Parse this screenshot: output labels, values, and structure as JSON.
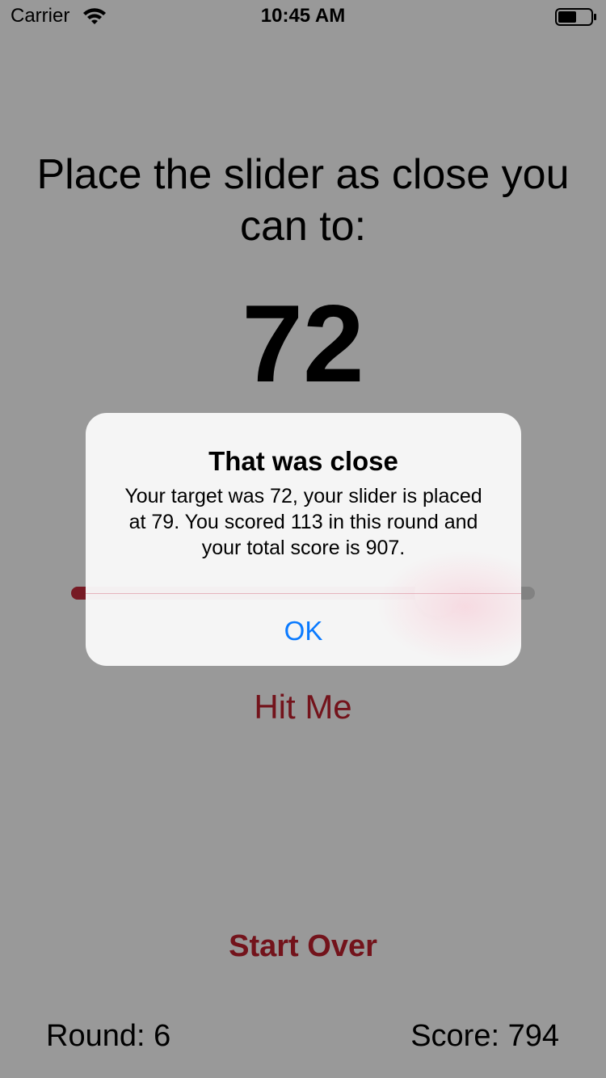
{
  "status_bar": {
    "carrier": "Carrier",
    "time": "10:45 AM",
    "wifi_icon": "wifi-icon",
    "battery_icon": "battery-icon"
  },
  "game": {
    "instruction": "Place the slider as close you can to:",
    "target": "72",
    "slider_value_fraction": 0.79,
    "hit_label": "Hit Me",
    "start_over_label": "Start Over",
    "round_text": "Round: 6",
    "score_text": "Score: 794"
  },
  "alert": {
    "title": "That was close",
    "message": "Your target was 72, your slider is placed at 79. You scored 113 in this round and your total score is 907.",
    "ok_label": "OK"
  },
  "colors": {
    "accent_red": "#c0202e",
    "slider_red": "#c62c3c",
    "ok_blue": "#0a7aff"
  }
}
